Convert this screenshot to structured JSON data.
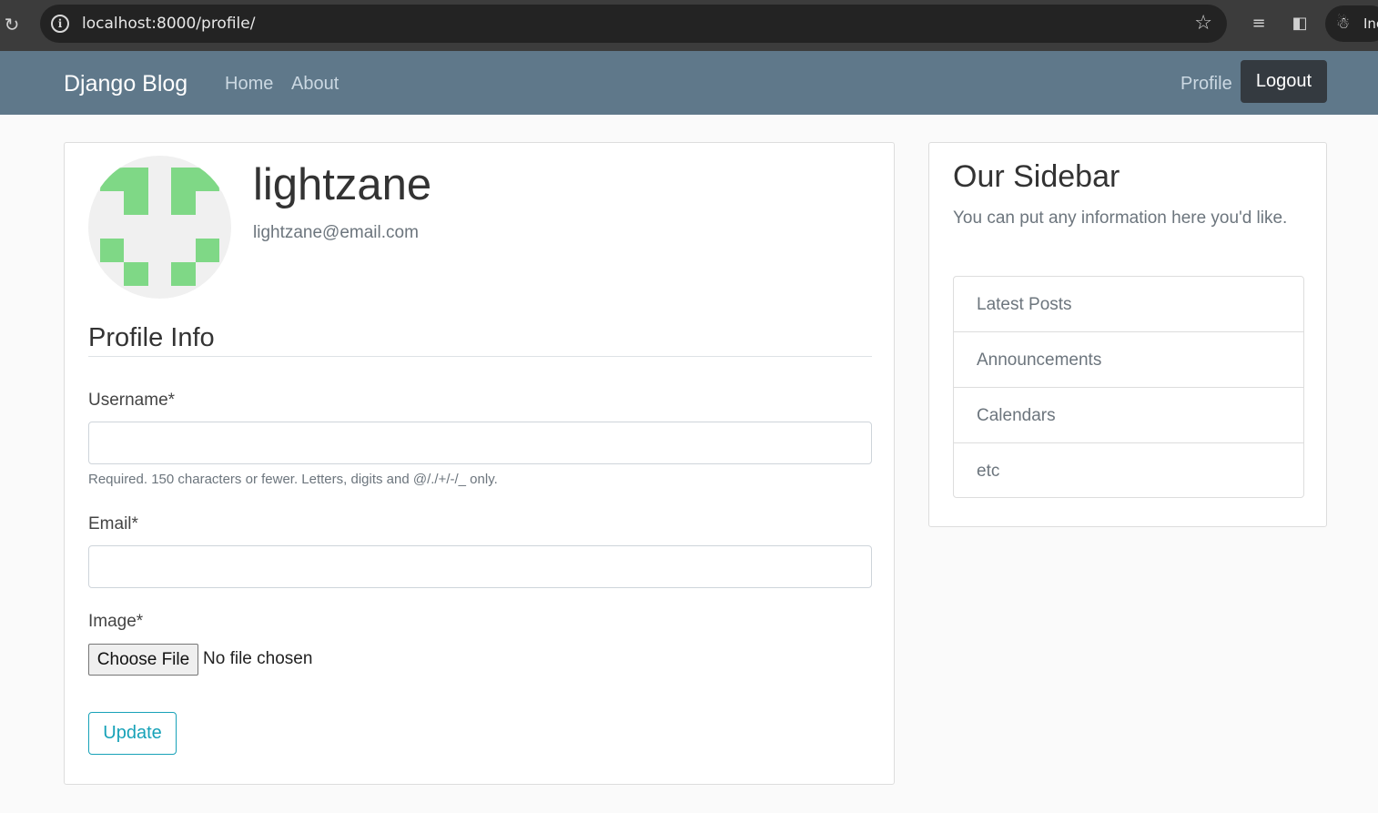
{
  "browser": {
    "url": "localhost:8000/profile/",
    "incognito_label": "Inc"
  },
  "navbar": {
    "brand": "Django Blog",
    "links": [
      "Home",
      "About"
    ],
    "profile": "Profile",
    "logout": "Logout"
  },
  "profile": {
    "username": "lightzane",
    "email": "lightzane@email.com"
  },
  "form": {
    "title": "Profile Info",
    "username_label": "Username*",
    "username_help": "Required. 150 characters or fewer. Letters, digits and @/./+/-/_ only.",
    "email_label": "Email*",
    "image_label": "Image*",
    "choose_file": "Choose File",
    "no_file": "No file chosen",
    "update": "Update"
  },
  "sidebar": {
    "title": "Our Sidebar",
    "text": "You can put any information here you'd like.",
    "items": [
      "Latest Posts",
      "Announcements",
      "Calendars",
      "etc"
    ]
  },
  "colors": {
    "navbar": "#5f788a",
    "logout_bg": "#343a40",
    "accent": "#17a2b8",
    "avatar_pixels": "#7fd886"
  }
}
